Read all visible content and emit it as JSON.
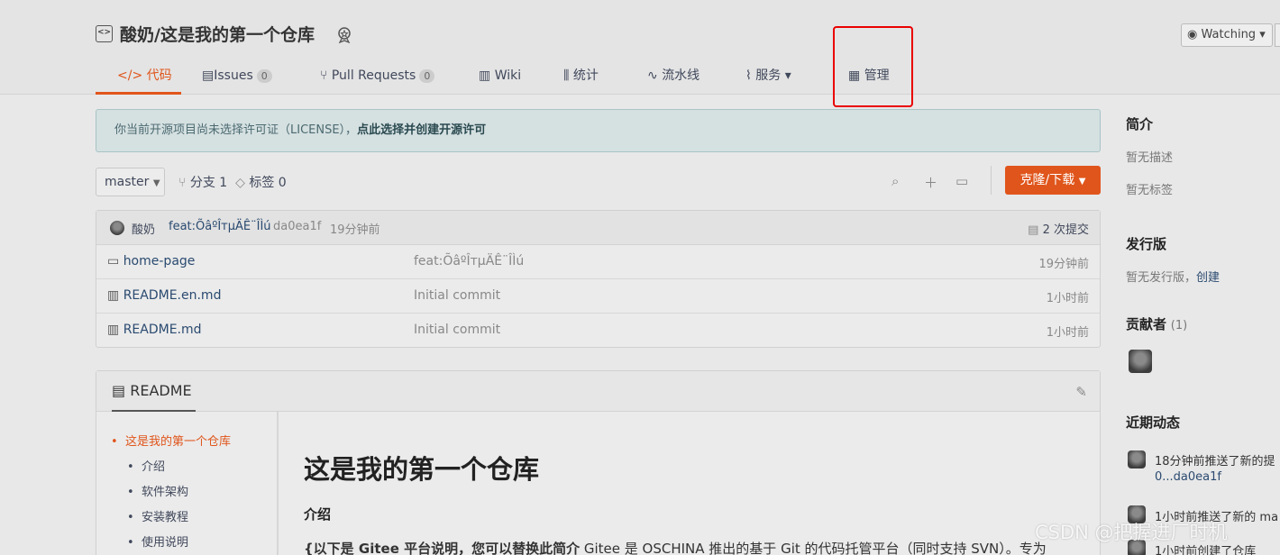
{
  "repo": {
    "title": "酸奶/这是我的第一个仓库",
    "watch_label": "Watching"
  },
  "tabs": [
    {
      "label": "代码",
      "icon": "code-icon"
    },
    {
      "label": "Issues",
      "count": "0",
      "icon": "issues-icon"
    },
    {
      "label": "Pull Requests",
      "count": "0",
      "icon": "pull-request-icon"
    },
    {
      "label": "Wiki",
      "icon": "wiki-icon"
    },
    {
      "label": "统计",
      "icon": "chart-icon"
    },
    {
      "label": "流水线",
      "icon": "pipeline-icon"
    },
    {
      "label": "服务",
      "icon": "pulse-icon"
    },
    {
      "label": "管理",
      "icon": "settings-doc-icon"
    }
  ],
  "notice": {
    "text": "你当前开源项目尚未选择许可证（LICENSE），",
    "link": "点此选择并创建开源许可"
  },
  "branch": {
    "name": "master",
    "branches": "分支 1",
    "tags": "标签 0"
  },
  "clone_label": "克隆/下载",
  "commit": {
    "author": "酸奶",
    "message": "feat:ÕâºÎтµÄÊ¨ÎÌú",
    "hash": "da0ea1f",
    "time": "19分钟前",
    "commits": "2 次提交"
  },
  "files": [
    {
      "name": "home-page",
      "type": "folder",
      "message": "feat:ÕâºÎтµÄÊ¨ÎÌú",
      "time": "19分钟前"
    },
    {
      "name": "README.en.md",
      "type": "file",
      "message": "Initial commit",
      "time": "1小时前"
    },
    {
      "name": "README.md",
      "type": "file",
      "message": "Initial commit",
      "time": "1小时前"
    }
  ],
  "readme": {
    "title": "README",
    "toc": [
      "这是我的第一个仓库",
      "介绍",
      "软件架构",
      "安装教程",
      "使用说明"
    ],
    "h1": "这是我的第一个仓库",
    "h3": "介绍",
    "p_bold": "{以下是 Gitee 平台说明，您可以替换此简介",
    "p_rest": " Gitee 是 OSCHINA 推出的基于 Git 的代码托管平台（同时支持 SVN）。专为"
  },
  "sidebar": {
    "intro_title": "简介",
    "no_desc": "暂无描述",
    "no_tags": "暂无标签",
    "release_title": "发行版",
    "no_release": "暂无发行版，",
    "create": "创建",
    "contrib_title": "贡献者",
    "contrib_count": "(1)",
    "activity_title": "近期动态",
    "activity": [
      {
        "text": "18分钟前推送了新的提",
        "sub": "0...da0ea1f"
      },
      {
        "text": "1小时前推送了新的 ma"
      },
      {
        "text": "1小时前创建了仓库"
      }
    ]
  },
  "watermark": "CSDN @把握进厂时机",
  "colors": {
    "accent": "#e0551b",
    "highlight": "#ea0000"
  }
}
